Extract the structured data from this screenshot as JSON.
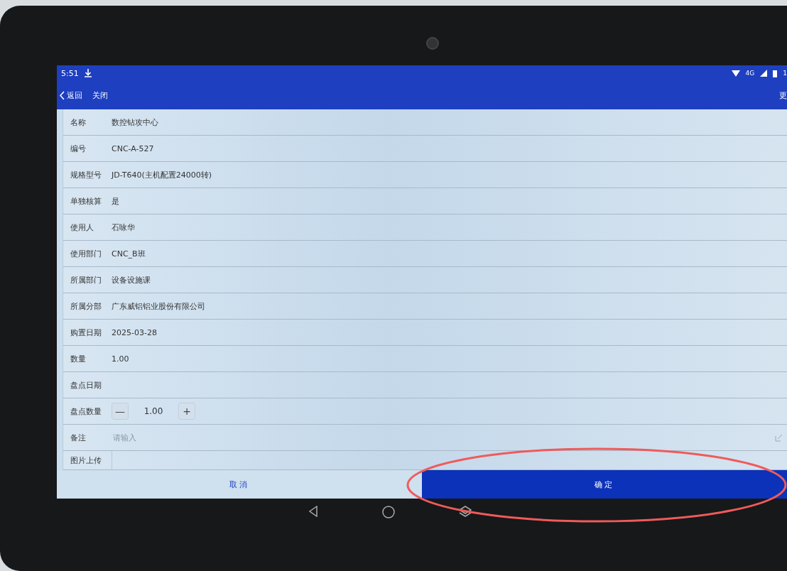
{
  "status_bar": {
    "time": "5:51",
    "network": "4G",
    "battery_text": "1"
  },
  "header": {
    "back": "返回",
    "close": "关闭",
    "right_action": "更"
  },
  "fields": [
    {
      "kind": "text",
      "label": "名称",
      "value": "数控钻攻中心"
    },
    {
      "kind": "text",
      "label": "编号",
      "value": "CNC-A-527"
    },
    {
      "kind": "text",
      "label": "规格型号",
      "value": "JD-T640(主机配置24000转)"
    },
    {
      "kind": "text",
      "label": "单独核算",
      "value": "是"
    },
    {
      "kind": "text",
      "label": "使用人",
      "value": "石咏华"
    },
    {
      "kind": "text",
      "label": "使用部门",
      "value": "CNC_B班"
    },
    {
      "kind": "text",
      "label": "所属部门",
      "value": "设备设施课"
    },
    {
      "kind": "text",
      "label": "所属分部",
      "value": "广东威铝铝业股份有限公司"
    },
    {
      "kind": "text",
      "label": "购置日期",
      "value": "2025-03-28"
    },
    {
      "kind": "text",
      "label": "数量",
      "value": "1.00"
    },
    {
      "kind": "text",
      "label": "盘点日期"
    },
    {
      "kind": "stepper",
      "label": "盘点数量",
      "value": "1.00",
      "minus": "—",
      "plus": "+"
    },
    {
      "kind": "input",
      "label": "备注",
      "placeholder": "请输入"
    },
    {
      "kind": "upload",
      "label": "图片上传"
    }
  ],
  "buttons": [
    {
      "label": "取消",
      "primary": false
    },
    {
      "label": "确定",
      "primary": true
    }
  ]
}
